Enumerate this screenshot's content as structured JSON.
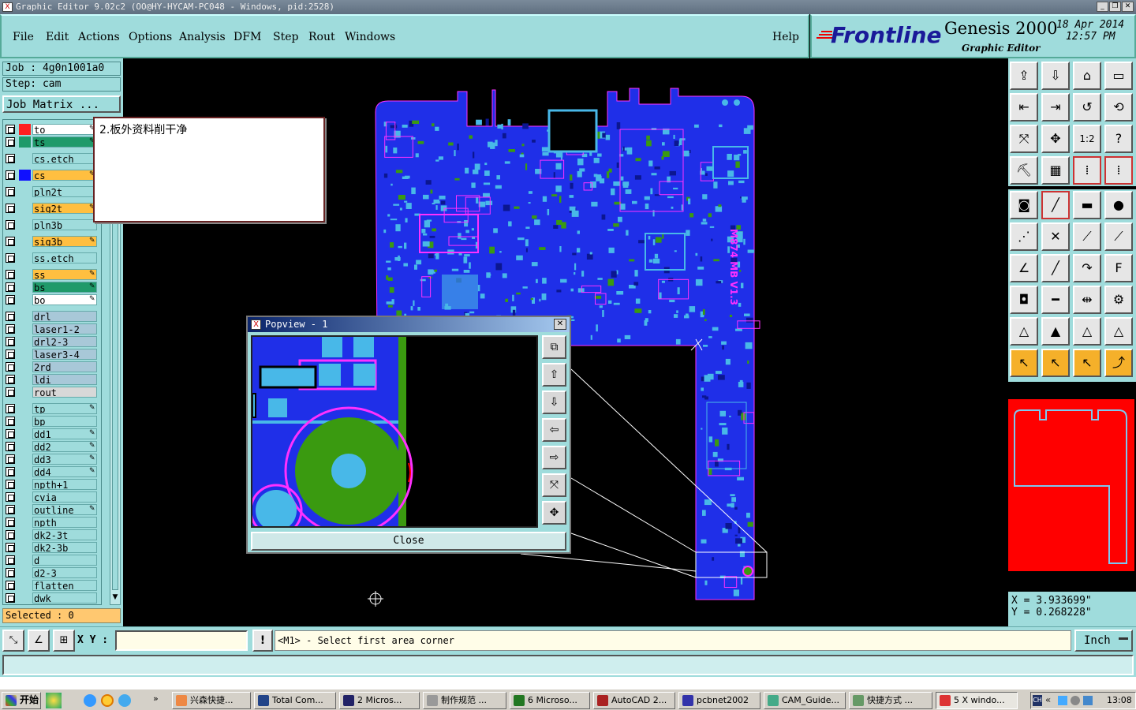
{
  "window": {
    "title": "Graphic Editor 9.02c2 (OO@HY-HYCAM-PC048 - Windows, pid:2528)",
    "min": "_",
    "restore": "❐",
    "close": "✕"
  },
  "menu": [
    "File",
    "Edit",
    "Actions",
    "Options",
    "Analysis",
    "DFM",
    "Step",
    "Rout",
    "Windows"
  ],
  "help": "Help",
  "brand": {
    "logo": "Frontline",
    "product": "Genesis 2000",
    "subtitle": "Graphic Editor",
    "date": "18 Apr 2014",
    "time": "12:57 PM"
  },
  "job": {
    "job_line": "Job : 4g0n1001a0",
    "step_line": "Step: cam",
    "matrix_button": "Job Matrix ..."
  },
  "layers": [
    {
      "name": "to",
      "color": "#ffffff",
      "swatch": "#ff2020",
      "ed": true
    },
    {
      "name": "ts",
      "color": "#1f9a6a",
      "swatch": "#1f9a6a",
      "ed": true
    },
    {
      "name": "cs.etch",
      "color": "#9fdcdc",
      "swatch": "",
      "ed": false
    },
    {
      "name": "cs",
      "color": "#ffbf40",
      "swatch": "#1010ff",
      "ed": true
    },
    {
      "name": "pln2t",
      "color": "#9fdcdc",
      "swatch": "",
      "ed": false
    },
    {
      "name": "sig2t",
      "color": "#ffbf40",
      "swatch": "",
      "ed": true
    },
    {
      "name": "pln3b",
      "color": "#9fdcdc",
      "swatch": "",
      "ed": false
    },
    {
      "name": "sig3b",
      "color": "#ffbf40",
      "swatch": "",
      "ed": true
    },
    {
      "name": "ss.etch",
      "color": "#9fdcdc",
      "swatch": "",
      "ed": false
    },
    {
      "name": "ss",
      "color": "#ffbf40",
      "swatch": "",
      "ed": true
    },
    {
      "name": "bs",
      "color": "#1f9a6a",
      "swatch": "",
      "ed": true
    },
    {
      "name": "bo",
      "color": "#ffffff",
      "swatch": "",
      "ed": true
    },
    {
      "name": "drl",
      "color": "#a8c8d8",
      "swatch": "",
      "ed": false
    },
    {
      "name": "laser1-2",
      "color": "#a8c8d8",
      "swatch": "",
      "ed": false
    },
    {
      "name": "drl2-3",
      "color": "#a8c8d8",
      "swatch": "",
      "ed": false
    },
    {
      "name": "laser3-4",
      "color": "#a8c8d8",
      "swatch": "",
      "ed": false
    },
    {
      "name": "2rd",
      "color": "#a8c8d8",
      "swatch": "",
      "ed": false
    },
    {
      "name": "ldi",
      "color": "#a8c8d8",
      "swatch": "",
      "ed": false
    },
    {
      "name": "rout",
      "color": "#d8d8d8",
      "swatch": "",
      "ed": false
    },
    {
      "name": "tp",
      "color": "#9fdcdc",
      "swatch": "",
      "ed": true
    },
    {
      "name": "bp",
      "color": "#9fdcdc",
      "swatch": "",
      "ed": false
    },
    {
      "name": "dd1",
      "color": "#9fdcdc",
      "swatch": "",
      "ed": true
    },
    {
      "name": "dd2",
      "color": "#9fdcdc",
      "swatch": "",
      "ed": true
    },
    {
      "name": "dd3",
      "color": "#9fdcdc",
      "swatch": "",
      "ed": true
    },
    {
      "name": "dd4",
      "color": "#9fdcdc",
      "swatch": "",
      "ed": true
    },
    {
      "name": "npth+1",
      "color": "#9fdcdc",
      "swatch": "",
      "ed": false
    },
    {
      "name": "cvia",
      "color": "#9fdcdc",
      "swatch": "",
      "ed": false
    },
    {
      "name": "outline",
      "color": "#9fdcdc",
      "swatch": "",
      "ed": true
    },
    {
      "name": "npth",
      "color": "#9fdcdc",
      "swatch": "",
      "ed": false
    },
    {
      "name": "dk2-3t",
      "color": "#9fdcdc",
      "swatch": "",
      "ed": false
    },
    {
      "name": "dk2-3b",
      "color": "#9fdcdc",
      "swatch": "",
      "ed": false
    },
    {
      "name": "d",
      "color": "#9fdcdc",
      "swatch": "",
      "ed": false
    },
    {
      "name": "d2-3",
      "color": "#9fdcdc",
      "swatch": "",
      "ed": false
    },
    {
      "name": "flatten",
      "color": "#9fdcdc",
      "swatch": "",
      "ed": false
    },
    {
      "name": "dwk",
      "color": "#9fdcdc",
      "swatch": "",
      "ed": false
    }
  ],
  "selected": "Selected : 0",
  "note": "2.板外资料削干净",
  "board_label": "M874 MB V1.3",
  "popview": {
    "title": "Popview - 1",
    "close": "Close"
  },
  "coords": {
    "x": "X = 3.933699\"",
    "y": "Y = 0.268228\""
  },
  "status": {
    "xy_label": "X Y :",
    "xy_value": "",
    "prompt": "<M1> - Select first area corner",
    "units": "Inch"
  },
  "taskbar": {
    "start": "开始",
    "items": [
      "兴森快捷...",
      "Total Com...",
      "2 Micros...",
      "制作规范 ...",
      "6 Microso...",
      "AutoCAD 2...",
      "pcbnet2002",
      "CAM_Guide...",
      "快捷方式 ...",
      "5 X windo..."
    ],
    "lang": "CH",
    "clock": "13:08"
  },
  "colors": {
    "cyan_panel": "#9fdcdc",
    "board_blue": "#1f2fe8",
    "magenta": "#ff30ff",
    "pad_cyan": "#48b8e8",
    "minimap_red": "#ff0000"
  }
}
